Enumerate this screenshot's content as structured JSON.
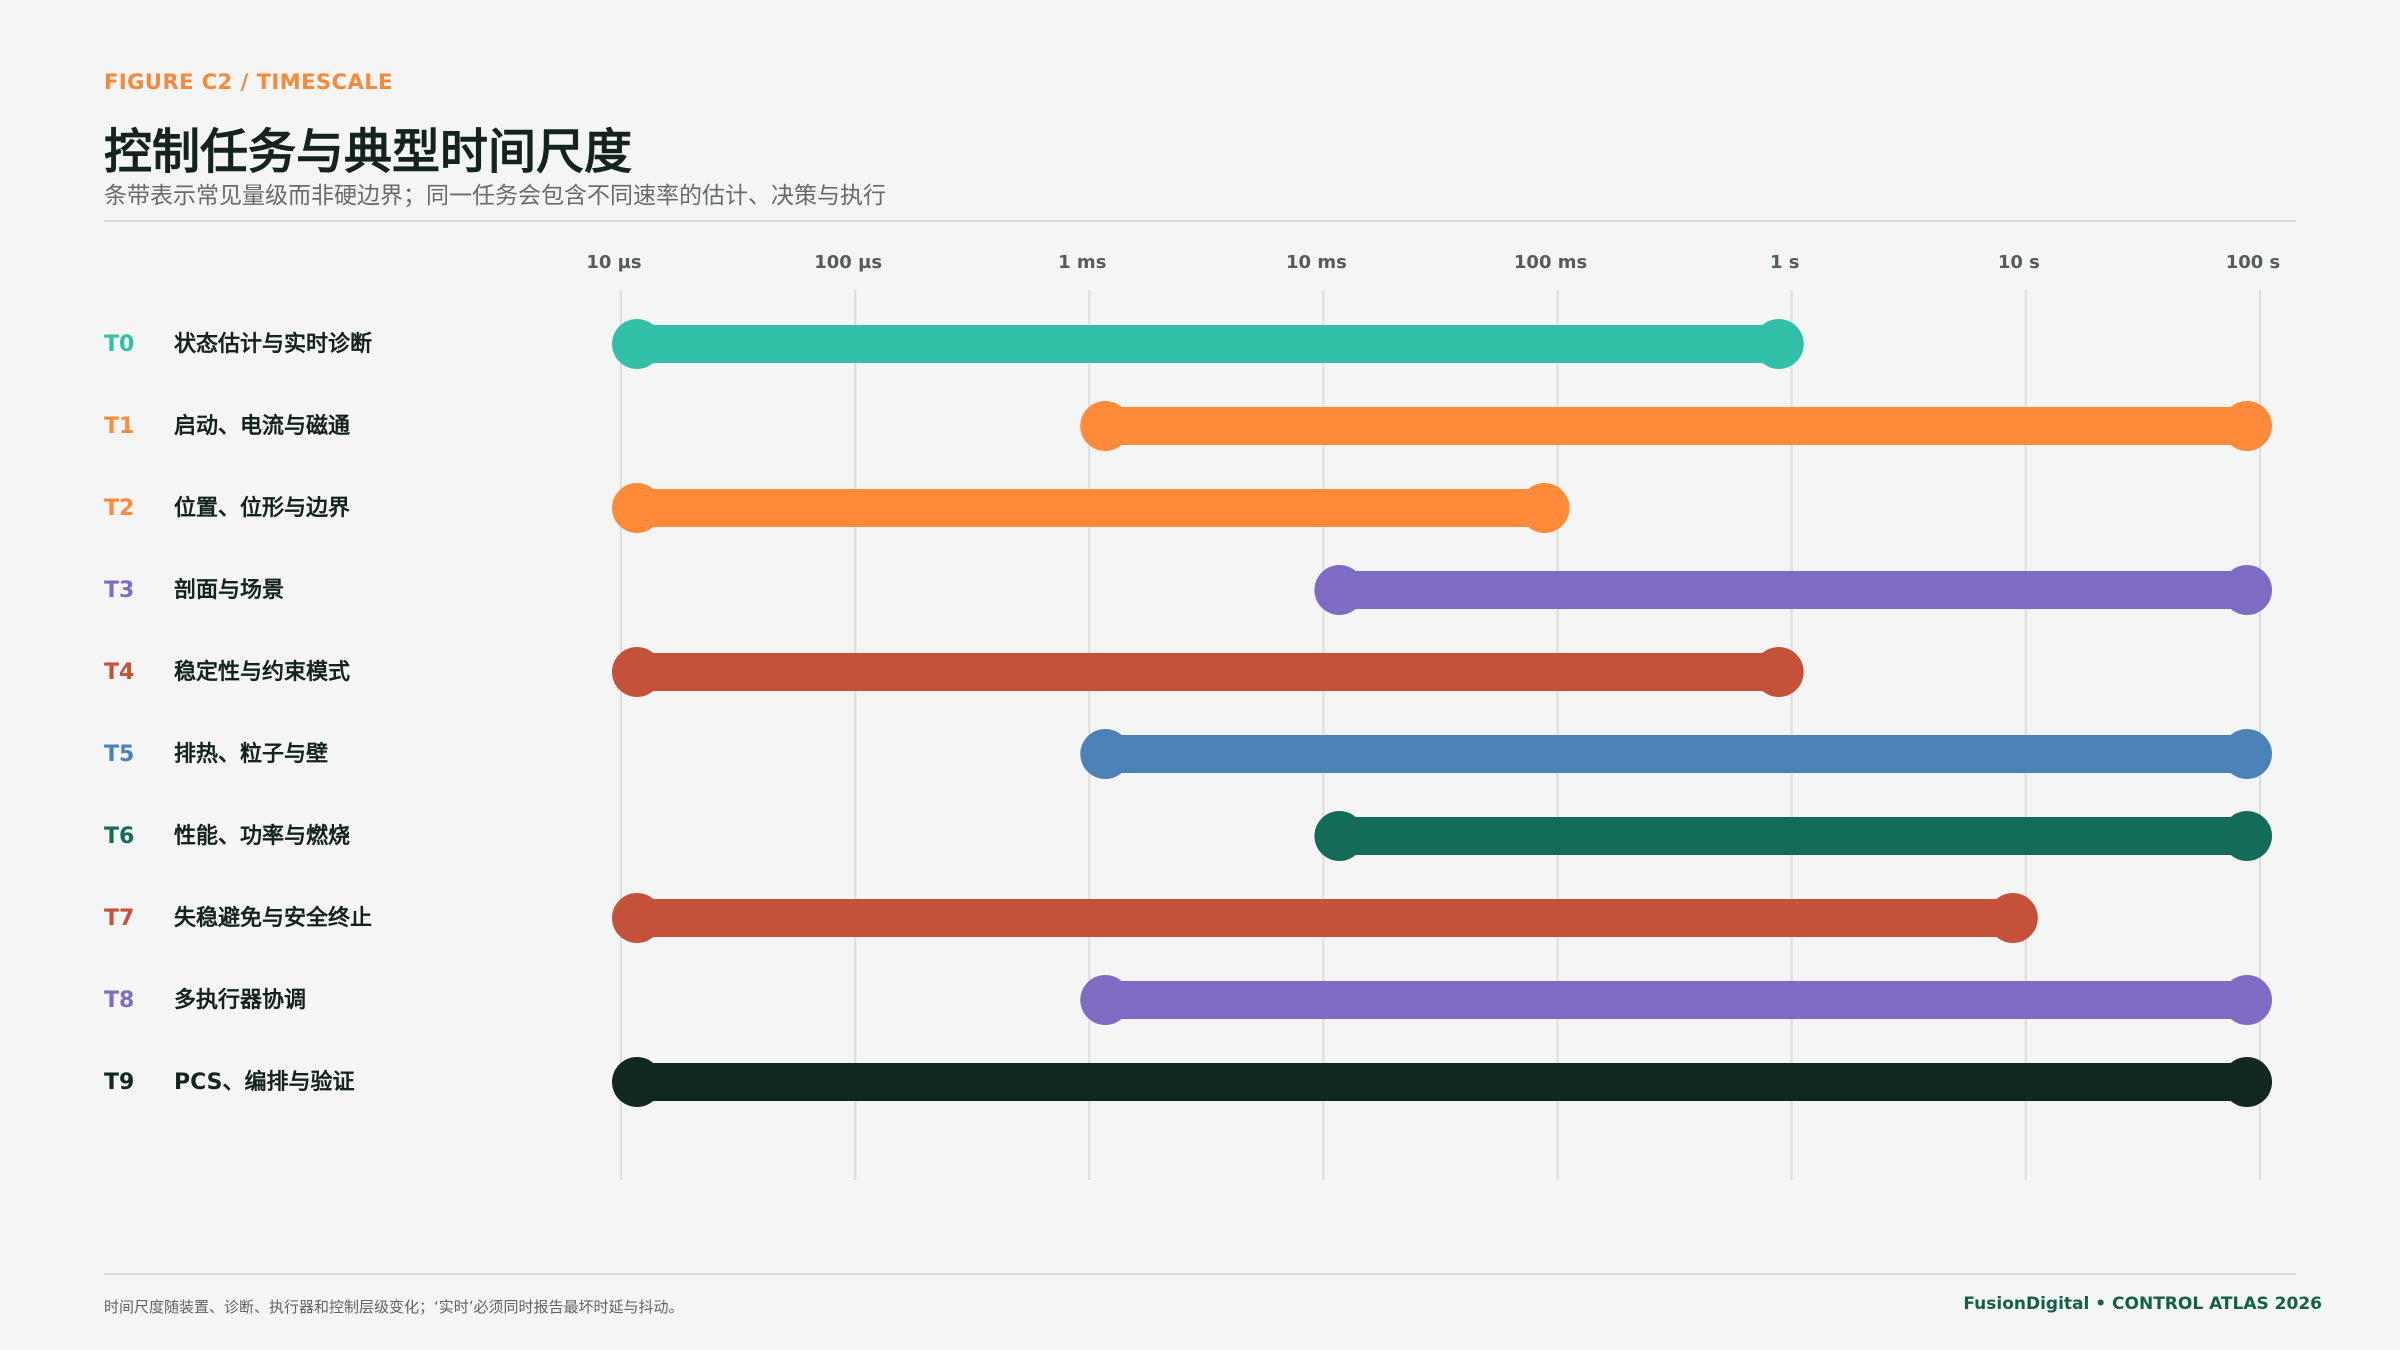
{
  "header": {
    "kicker": "FIGURE C2 / TIMESCALE",
    "title": "控制任务与典型时间尺度",
    "subtitle": "条带表示常见量级而非硬边界；同一任务会包含不同速率的估计、决策与执行"
  },
  "footer": {
    "note": "时间尺度随装置、诊断、执行器和控制层级变化；‘实时’必须同时报告最坏时延与抖动。",
    "brand": "FusionDigital • CONTROL ATLAS 2026"
  },
  "chart_data": {
    "type": "range-bar",
    "x_scale": "log",
    "x_unit": "seconds",
    "xlim": [
      1e-05,
      100
    ],
    "x_ticks": [
      {
        "value": 1e-05,
        "label": "10 µs"
      },
      {
        "value": 0.0001,
        "label": "100 µs"
      },
      {
        "value": 0.001,
        "label": "1 ms"
      },
      {
        "value": 0.01,
        "label": "10 ms"
      },
      {
        "value": 0.1,
        "label": "100 ms"
      },
      {
        "value": 1,
        "label": "1 s"
      },
      {
        "value": 10,
        "label": "10 s"
      },
      {
        "value": 100,
        "label": "100 s"
      }
    ],
    "grid": true,
    "rows": [
      {
        "id": "T0",
        "label": "状态估计与实时诊断",
        "start": 1e-05,
        "end": 1,
        "color": "#31bfa7"
      },
      {
        "id": "T1",
        "label": "启动、电流与磁通",
        "start": 0.001,
        "end": 100,
        "color": "#ff8a3a"
      },
      {
        "id": "T2",
        "label": "位置、位形与边界",
        "start": 1e-05,
        "end": 0.1,
        "color": "#ff8a3a"
      },
      {
        "id": "T3",
        "label": "剖面与场景",
        "start": 0.01,
        "end": 100,
        "color": "#7e6cc4"
      },
      {
        "id": "T4",
        "label": "稳定性与约束模式",
        "start": 1e-05,
        "end": 1,
        "color": "#c4523a"
      },
      {
        "id": "T5",
        "label": "排热、粒子与壁",
        "start": 0.001,
        "end": 100,
        "color": "#4a82b8"
      },
      {
        "id": "T6",
        "label": "性能、功率与燃烧",
        "start": 0.01,
        "end": 100,
        "color": "#136b58"
      },
      {
        "id": "T7",
        "label": "失稳避免与安全终止",
        "start": 1e-05,
        "end": 10,
        "color": "#c4523a"
      },
      {
        "id": "T8",
        "label": "多执行器协调",
        "start": 0.001,
        "end": 100,
        "color": "#7e6cc4"
      },
      {
        "id": "T9",
        "label": "PCS、编排与验证",
        "start": 1e-05,
        "end": 100,
        "color": "#11281f"
      }
    ]
  }
}
